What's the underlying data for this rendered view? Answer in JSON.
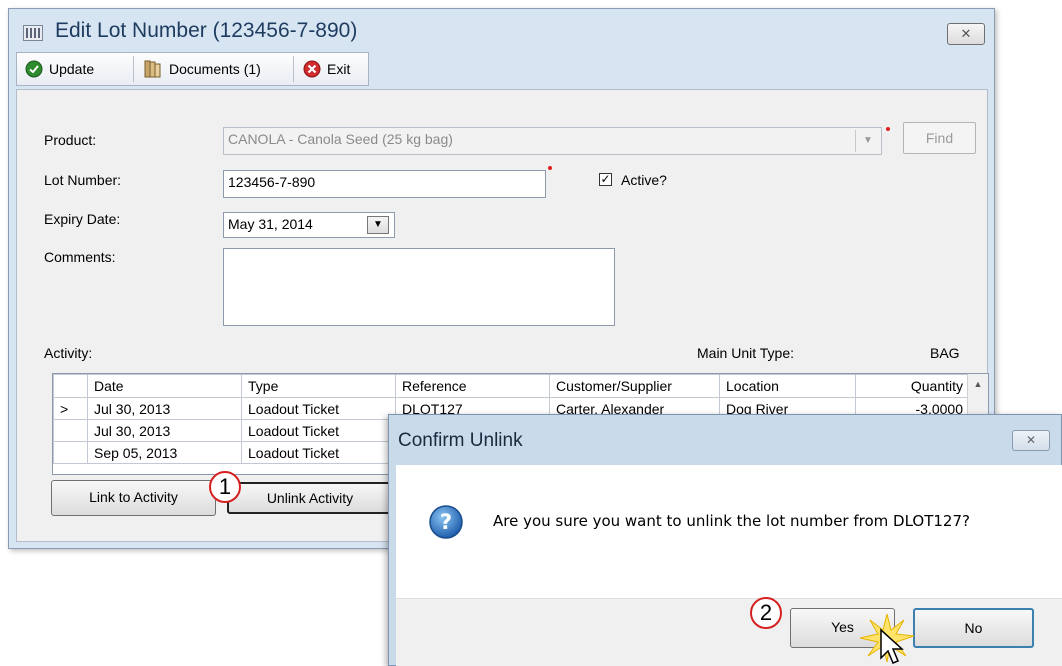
{
  "main_window": {
    "title": "Edit Lot Number (123456-7-890)",
    "toolbar": {
      "update_label": "Update",
      "documents_label": "Documents (1)",
      "exit_label": "Exit"
    },
    "form": {
      "product_label": "Product:",
      "product_value": "CANOLA - Canola Seed (25 kg bag)",
      "find_label": "Find",
      "lot_number_label": "Lot Number:",
      "lot_number_value": "123456-7-890",
      "active_label": "Active?",
      "active_checked": true,
      "expiry_label": "Expiry Date:",
      "expiry_value": "May 31, 2014",
      "comments_label": "Comments:",
      "comments_value": ""
    },
    "activity": {
      "label": "Activity:",
      "main_unit_type_label": "Main Unit Type:",
      "main_unit_type_value": "BAG",
      "columns": [
        "Date",
        "Type",
        "Reference",
        "Customer/Supplier",
        "Location",
        "Quantity"
      ],
      "rows": [
        {
          "marker": ">",
          "date": "Jul 30, 2013",
          "type": "Loadout Ticket",
          "reference": "DLOT127",
          "customer": "Carter, Alexander",
          "location": "Dog River",
          "quantity": "-3.0000"
        },
        {
          "marker": "",
          "date": "Jul 30, 2013",
          "type": "Loadout Ticket",
          "reference": "",
          "customer": "",
          "location": "",
          "quantity": ""
        },
        {
          "marker": "",
          "date": "Sep 05, 2013",
          "type": "Loadout Ticket",
          "reference": "",
          "customer": "",
          "location": "",
          "quantity": ""
        }
      ],
      "link_button": "Link to Activity",
      "unlink_button": "Unlink Activity"
    }
  },
  "dialog": {
    "title": "Confirm Unlink",
    "message": "Are you sure you want to unlink the lot number from DLOT127?",
    "yes_label": "Yes",
    "no_label": "No"
  },
  "callouts": {
    "step1": "1",
    "step2": "2"
  },
  "icons": {
    "close": "close-icon",
    "update": "check-circle-icon",
    "documents": "documents-icon",
    "exit": "exit-icon",
    "question": "question-icon"
  },
  "colors": {
    "window_bg": "#d7e4f2",
    "dialog_bg": "#c9daeb",
    "required": "#e02020",
    "callout_ring": "#d62020"
  }
}
